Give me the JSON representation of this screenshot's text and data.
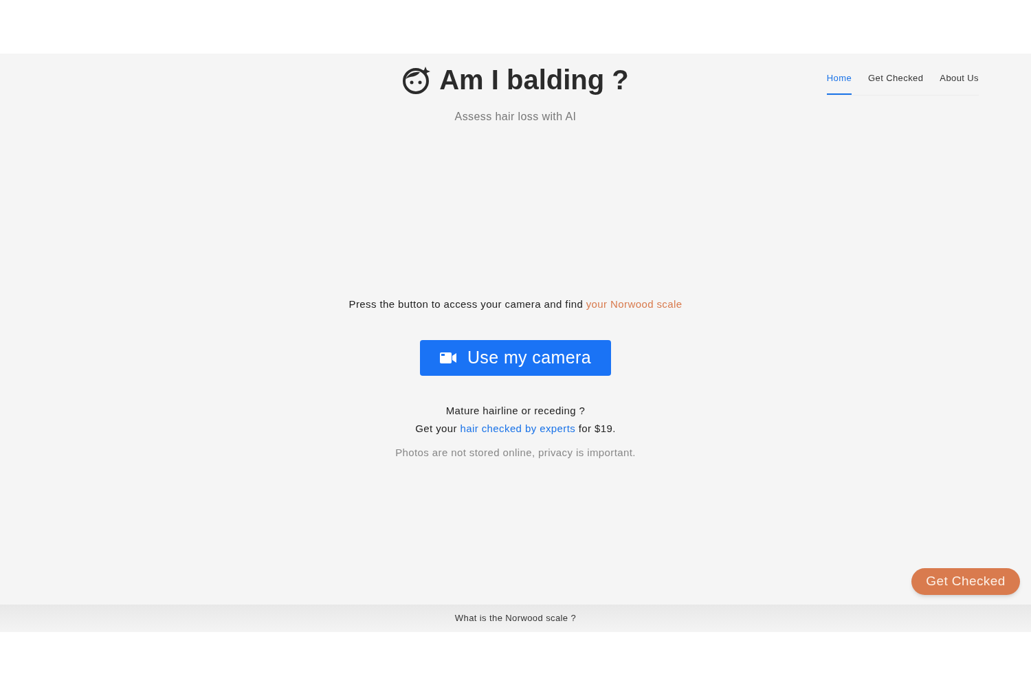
{
  "header": {
    "title": "Am I balding ?",
    "subtitle": "Assess hair loss with AI"
  },
  "nav": [
    {
      "label": "Home",
      "selected": true
    },
    {
      "label": "Get Checked",
      "selected": false
    },
    {
      "label": "About Us",
      "selected": false
    }
  ],
  "main": {
    "prompt": {
      "text": "Press the button to access your camera and find",
      "link": "your Norwood scale"
    },
    "camera_button": "Use my camera",
    "question": "Mature hairline or receding ?",
    "offer": {
      "before": "Get your",
      "link": "hair checked by experts",
      "after": "for $19."
    },
    "privacy": "Photos are not stored online, privacy is important."
  },
  "floating_button": "Get Checked",
  "footer": {
    "link": "What is the Norwood scale ?"
  }
}
